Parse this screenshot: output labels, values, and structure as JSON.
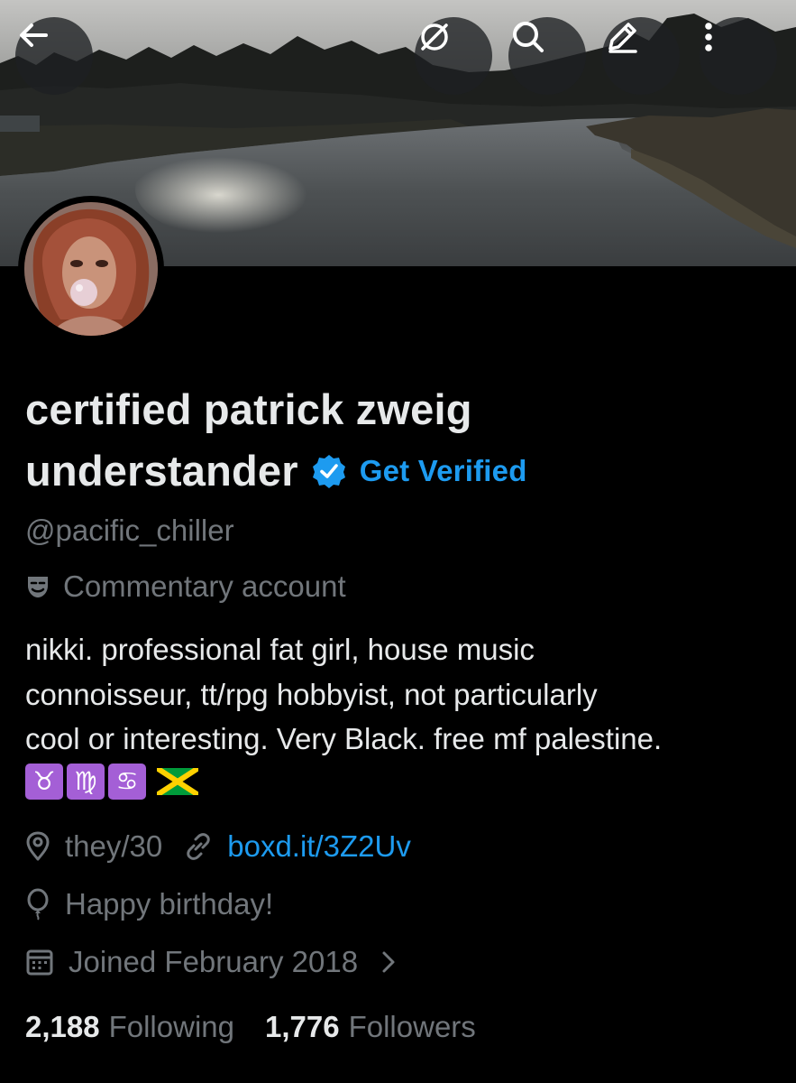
{
  "header": {
    "back_icon": "arrow-left-icon",
    "grok_icon": "slashed-circle-icon",
    "search_icon": "search-icon",
    "edit_icon": "pencil-icon",
    "more_icon": "more-vertical-icon"
  },
  "profile": {
    "display_name_line1": "certified patrick zweig",
    "display_name_line2": "understander",
    "get_verified_label": "Get Verified",
    "handle": "@pacific_chiller",
    "category": "Commentary account",
    "bio_lines": [
      "nikki. professional fat girl, house music",
      "connoisseur, tt/rpg hobbyist, not particularly",
      "cool or interesting. Very Black. free mf palestine."
    ],
    "bio_emoji": [
      "♉",
      "♍",
      "♋",
      "jamaica-flag"
    ],
    "location": "they/30",
    "website": "boxd.it/3Z2Uv",
    "birthday": "Happy birthday!",
    "joined": "Joined February 2018"
  },
  "stats": {
    "following_count": "2,188",
    "following_label": "Following",
    "followers_count": "1,776",
    "followers_label": "Followers"
  },
  "colors": {
    "background": "#000000",
    "primary_text": "#e7e9ea",
    "secondary_text": "#71767b",
    "accent_blue": "#1d9bf0",
    "zodiac_purple": "#a45fd6"
  }
}
